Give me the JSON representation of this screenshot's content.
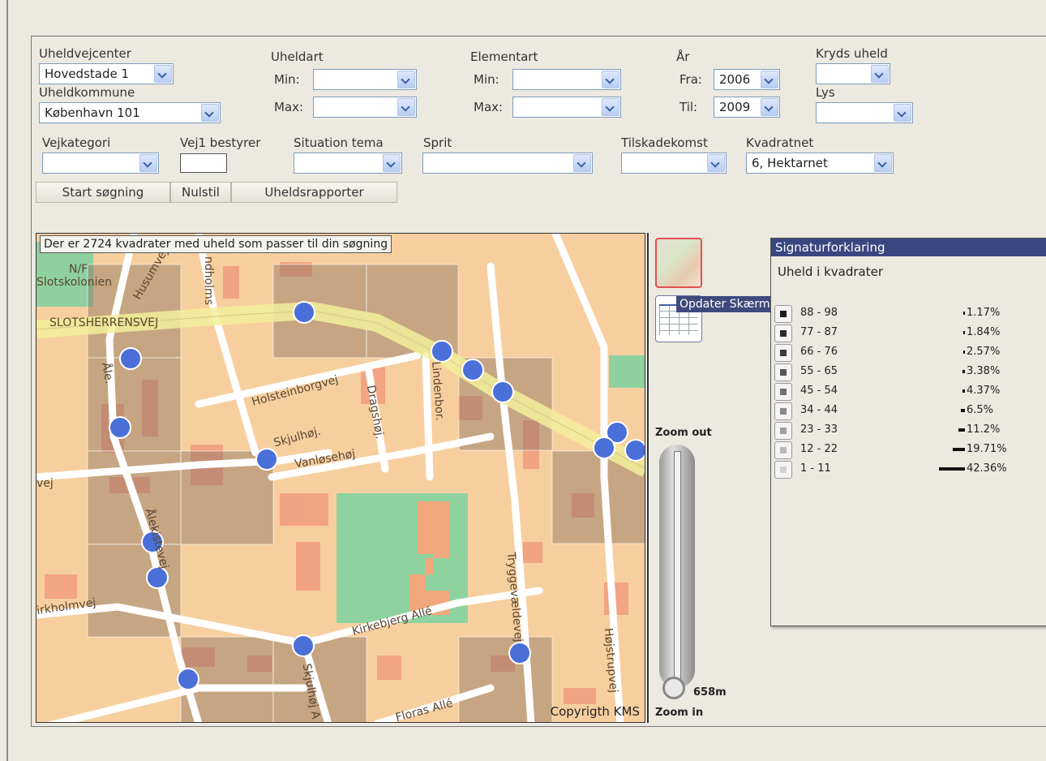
{
  "filters": {
    "uheldvejcenter": {
      "label": "Uheldvejcenter",
      "value": "Hovedstade 1"
    },
    "uheldkommune": {
      "label": "Uheldkommune",
      "value": "København 101"
    },
    "uheldart": {
      "label": "Uheldart",
      "min_label": "Min:",
      "max_label": "Max:",
      "min_value": "",
      "max_value": ""
    },
    "elementart": {
      "label": "Elementart",
      "min_label": "Min:",
      "max_label": "Max:",
      "min_value": "",
      "max_value": ""
    },
    "aar": {
      "label": "År",
      "fra_label": "Fra:",
      "fra_value": "2006",
      "til_label": "Til:",
      "til_value": "2009"
    },
    "kryds_uheld": {
      "label": "Kryds uheld",
      "value": ""
    },
    "lys": {
      "label": "Lys",
      "value": ""
    },
    "vejkategori": {
      "label": "Vejkategori",
      "value": ""
    },
    "vej1_bestyrer": {
      "label": "Vej1 bestyrer",
      "value": ""
    },
    "situation_tema": {
      "label": "Situation tema",
      "value": ""
    },
    "sprit": {
      "label": "Sprit",
      "value": ""
    },
    "tilskadekomst": {
      "label": "Tilskadekomst",
      "value": ""
    },
    "kvadratnet": {
      "label": "Kvadratnet",
      "value": "6, Hektarnet"
    }
  },
  "buttons": {
    "start": "Start søgning",
    "nulstil": "Nulstil",
    "rapporter": "Uheldsrapporter"
  },
  "map": {
    "message": "Der er 2724 kvadrater med uheld som passer til din søgning",
    "copyright": "Copyrigth KMS",
    "streets": [
      "N/F",
      "Slotskolonien",
      "Husumvej",
      "SLOTSHERRENSVEJ",
      "ndholms",
      "Åle.",
      "Holsteinborgvej",
      "Dragshøj.",
      "Lindenbor.",
      "Skjulhøj.",
      "Vanløsehøj",
      "vej",
      "Ålekistevej",
      "irkholmvej",
      "Kirkebjerg Allé",
      "Tryggevældevej",
      "Højstrupvej",
      "Skjulhøj A",
      "Floras Allé"
    ]
  },
  "side": {
    "tooltip": "Opdater Skærm",
    "zoom_out": "Zoom out",
    "zoom_in": "Zoom in",
    "scale": "658m"
  },
  "legend": {
    "title": "Signaturforklaring",
    "subtitle": "Uheld i kvadrater",
    "rows": [
      {
        "range": "88 - 98",
        "pct": "1.17%",
        "share": 1.17
      },
      {
        "range": "77 - 87",
        "pct": "1.84%",
        "share": 1.84
      },
      {
        "range": "66 - 76",
        "pct": "2.57%",
        "share": 2.57
      },
      {
        "range": "55 - 65",
        "pct": "3.38%",
        "share": 3.38
      },
      {
        "range": "45 - 54",
        "pct": "4.37%",
        "share": 4.37
      },
      {
        "range": "34 - 44",
        "pct": "6.5%",
        "share": 6.5
      },
      {
        "range": "23 - 33",
        "pct": "11.2%",
        "share": 11.2
      },
      {
        "range": "12 - 22",
        "pct": "19.71%",
        "share": 19.71
      },
      {
        "range": "1 - 11",
        "pct": "42.36%",
        "share": 42.36
      }
    ]
  },
  "colors": {
    "accent": "#3a4680",
    "marker": "#4a6fd8",
    "map_bg": "#f7cf9f"
  }
}
